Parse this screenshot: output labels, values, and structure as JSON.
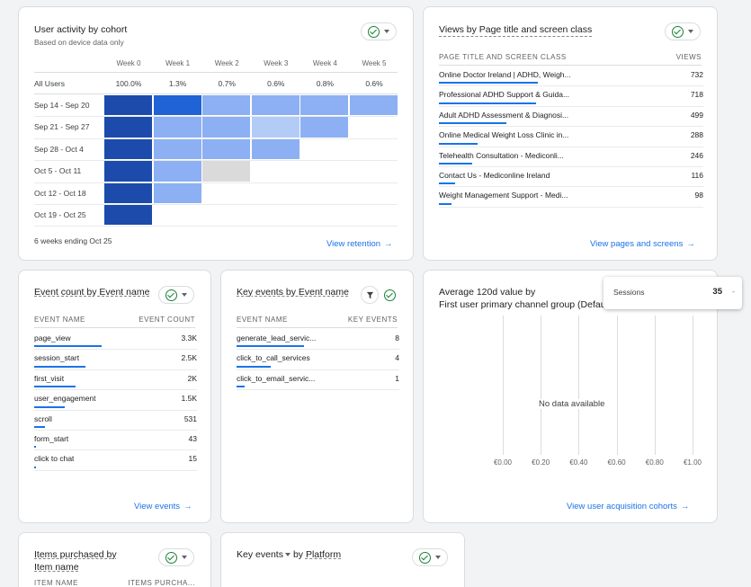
{
  "cohort": {
    "title": "User activity by cohort",
    "subtitle": "Based on device data only",
    "weeks": [
      "Week 0",
      "Week 1",
      "Week 2",
      "Week 3",
      "Week 4",
      "Week 5"
    ],
    "all_users_label": "All Users",
    "all_users_values": [
      "100.0%",
      "1.3%",
      "0.7%",
      "0.6%",
      "0.8%",
      "0.6%"
    ],
    "rows": [
      "Sep 14 - Sep 20",
      "Sep 21 - Sep 27",
      "Sep 28 - Oct 4",
      "Oct 5 - Oct 11",
      "Oct 12 - Oct 18",
      "Oct 19 - Oct 25"
    ],
    "footer": "6 weeks ending Oct 25",
    "link": "View retention",
    "heat": [
      [
        "#1c4bab",
        "#1f63d6",
        "#8cb0f3",
        "#8cb0f3",
        "#8cb0f3",
        "#8cb0f3"
      ],
      [
        "#1c4bab",
        "#8cb0f3",
        "#8cb0f3",
        "#b3cbf7",
        "#8cb0f3"
      ],
      [
        "#1c4bab",
        "#8cb0f3",
        "#8cb0f3",
        "#8cb0f3"
      ],
      [
        "#1c4bab",
        "#8cb0f3",
        "#dadada"
      ],
      [
        "#1c4bab",
        "#8cb0f3"
      ],
      [
        "#1c4bab"
      ]
    ]
  },
  "views": {
    "title": "Views by Page title and screen class",
    "col1": "PAGE TITLE AND SCREEN CLASS",
    "col2": "VIEWS",
    "rows": [
      {
        "label": "Online Doctor Ireland | ADHD, Weigh...",
        "value": "732",
        "pct": 1.0
      },
      {
        "label": "Professional ADHD Support & Guida...",
        "value": "718",
        "pct": 0.98
      },
      {
        "label": "Adult ADHD Assessment & Diagnosi...",
        "value": "499",
        "pct": 0.68
      },
      {
        "label": "Online Medical Weight Loss Clinic in...",
        "value": "288",
        "pct": 0.39
      },
      {
        "label": "Telehealth Consultation - Mediconli...",
        "value": "246",
        "pct": 0.34
      },
      {
        "label": "Contact Us - Mediconline Ireland",
        "value": "116",
        "pct": 0.16
      },
      {
        "label": "Weight Management Support - Medi...",
        "value": "98",
        "pct": 0.13
      }
    ],
    "link": "View pages and screens"
  },
  "events": {
    "title": "Event count by Event name",
    "col1": "EVENT NAME",
    "col2": "EVENT COUNT",
    "rows": [
      {
        "label": "page_view",
        "value": "3.3K",
        "pct": 1.0
      },
      {
        "label": "session_start",
        "value": "2.5K",
        "pct": 0.76
      },
      {
        "label": "first_visit",
        "value": "2K",
        "pct": 0.61
      },
      {
        "label": "user_engagement",
        "value": "1.5K",
        "pct": 0.45
      },
      {
        "label": "scroll",
        "value": "531",
        "pct": 0.16
      },
      {
        "label": "form_start",
        "value": "43",
        "pct": 0.02
      },
      {
        "label": "click to chat",
        "value": "15",
        "pct": 0.01
      }
    ],
    "link": "View events"
  },
  "key_events": {
    "title": "Key events by Event name",
    "col1": "EVENT NAME",
    "col2": "KEY EVENTS",
    "rows": [
      {
        "label": "generate_lead_servic...",
        "value": "8",
        "pct": 1.0
      },
      {
        "label": "click_to_call_services",
        "value": "4",
        "pct": 0.5
      },
      {
        "label": "click_to_email_servic...",
        "value": "1",
        "pct": 0.12
      }
    ]
  },
  "avg_value": {
    "title_line1": "Average 120d value by",
    "title_line2": "First user primary channel group (Default",
    "no_data": "No data available",
    "ticks": [
      "€0.00",
      "€0.20",
      "€0.40",
      "€0.60",
      "€0.80",
      "€1.00"
    ],
    "link": "View user acquisition cohorts",
    "tooltip_label": "Sessions",
    "tooltip_value": "35",
    "tooltip_extra": "-"
  },
  "items": {
    "title_line1": "Items purchased by",
    "title_line2": "Item name",
    "col1": "ITEM NAME",
    "col2": "ITEMS PURCHA..."
  },
  "platform": {
    "title_a": "Key events",
    "title_b": "by",
    "title_c": "Platform"
  },
  "arrow_glyph": "→"
}
